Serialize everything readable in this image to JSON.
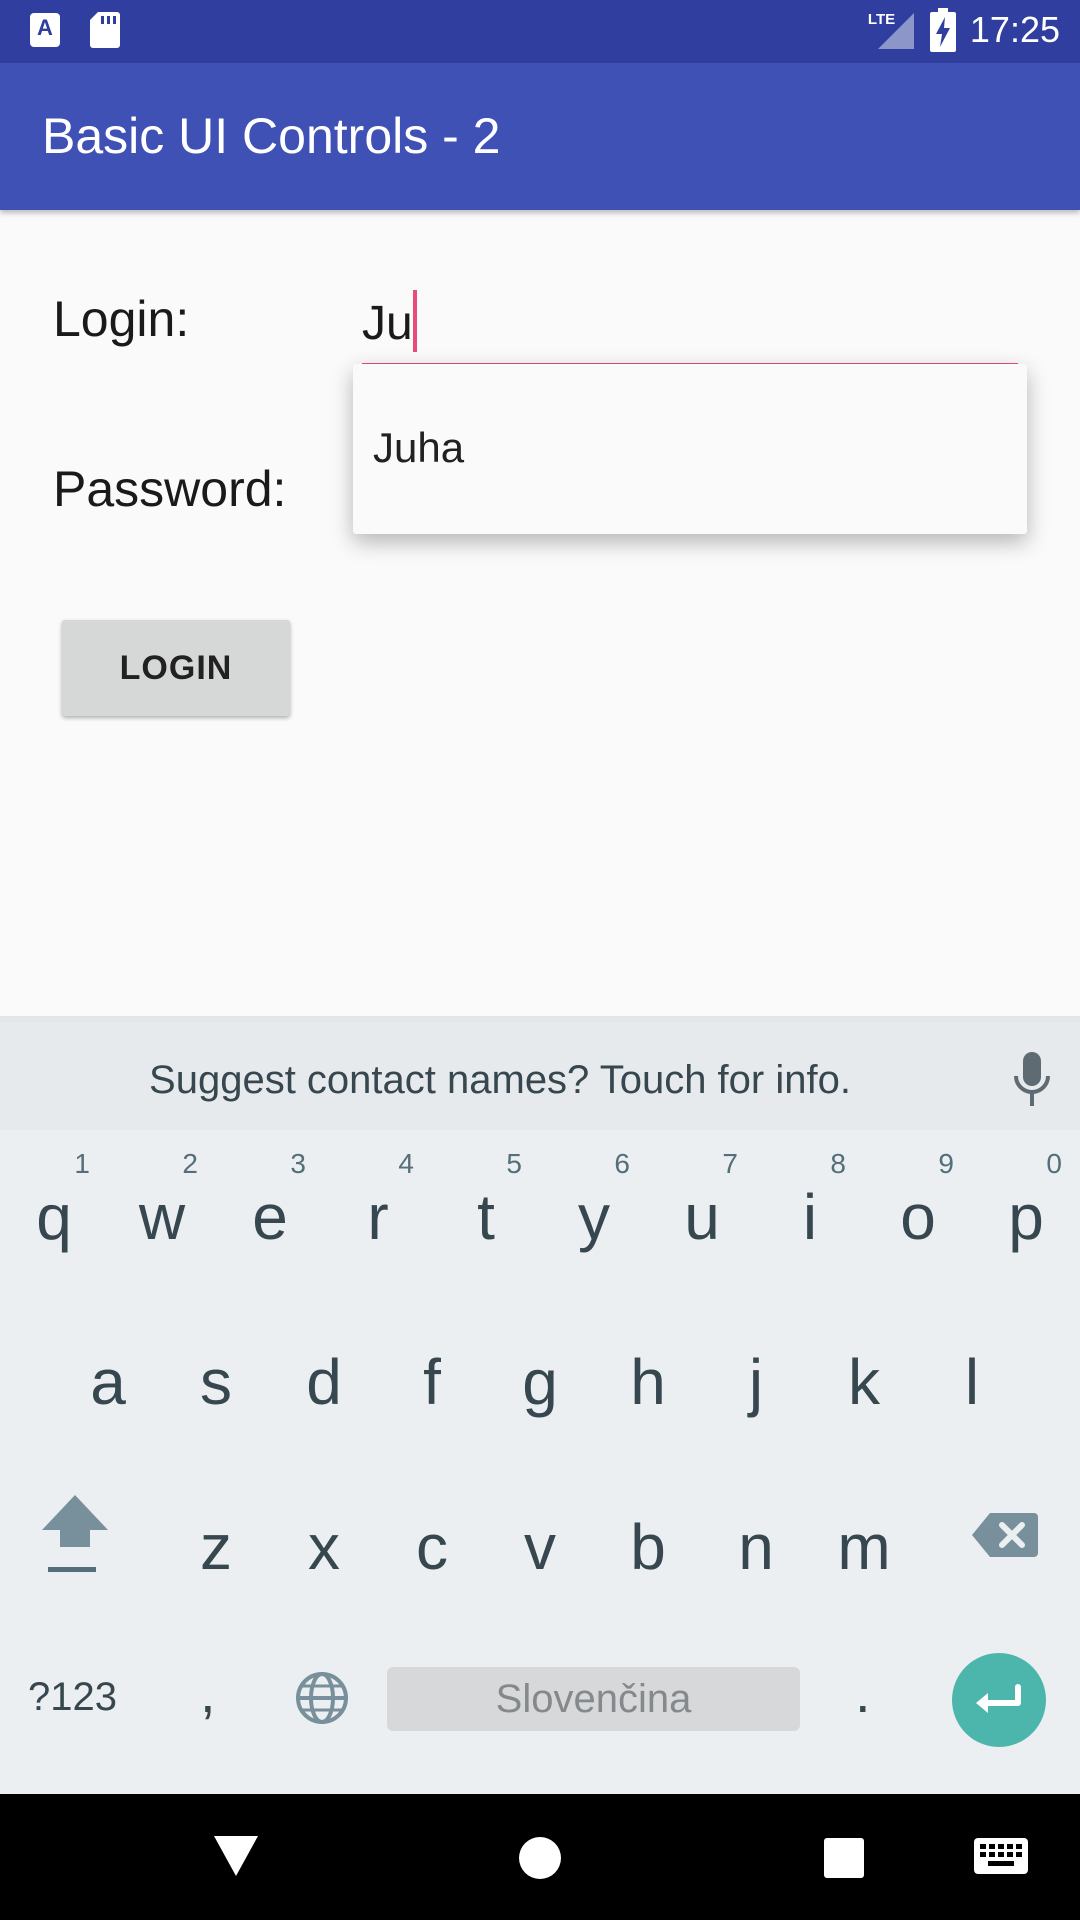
{
  "status_bar": {
    "time": "17:25",
    "network": "LTE",
    "notification_icons": [
      "app-notification-icon",
      "sd-card-icon"
    ],
    "status_icons": [
      "lte-signal-icon",
      "battery-charging-icon"
    ]
  },
  "app_bar": {
    "title": "Basic UI Controls - 2"
  },
  "form": {
    "login_label": "Login:",
    "login_value": "Ju",
    "password_label": "Password:",
    "autocomplete": [
      "Juha"
    ],
    "login_button": "LOGIN"
  },
  "keyboard": {
    "suggestion": "Suggest contact names? Touch for info.",
    "row1": [
      {
        "char": "q",
        "hint": "1"
      },
      {
        "char": "w",
        "hint": "2"
      },
      {
        "char": "e",
        "hint": "3"
      },
      {
        "char": "r",
        "hint": "4"
      },
      {
        "char": "t",
        "hint": "5"
      },
      {
        "char": "y",
        "hint": "6"
      },
      {
        "char": "u",
        "hint": "7"
      },
      {
        "char": "i",
        "hint": "8"
      },
      {
        "char": "o",
        "hint": "9"
      },
      {
        "char": "p",
        "hint": "0"
      }
    ],
    "row2": [
      "a",
      "s",
      "d",
      "f",
      "g",
      "h",
      "j",
      "k",
      "l"
    ],
    "row3": [
      "z",
      "x",
      "c",
      "v",
      "b",
      "n",
      "m"
    ],
    "symbols_label": "?123",
    "comma": ",",
    "space_label": "Slovenčina",
    "period": ".",
    "icons": [
      "shift-icon",
      "backspace-icon",
      "globe-icon",
      "enter-icon",
      "mic-icon"
    ]
  },
  "navigation_bar": {
    "icons": [
      "back-icon",
      "home-icon",
      "recents-icon",
      "keyboard-switch-icon"
    ]
  },
  "colors": {
    "status_bar": "#303f9f",
    "app_bar": "#3f51b5",
    "accent": "#e94c7a",
    "enter_key": "#4db6ac",
    "keyboard_bg": "#eceff1"
  }
}
